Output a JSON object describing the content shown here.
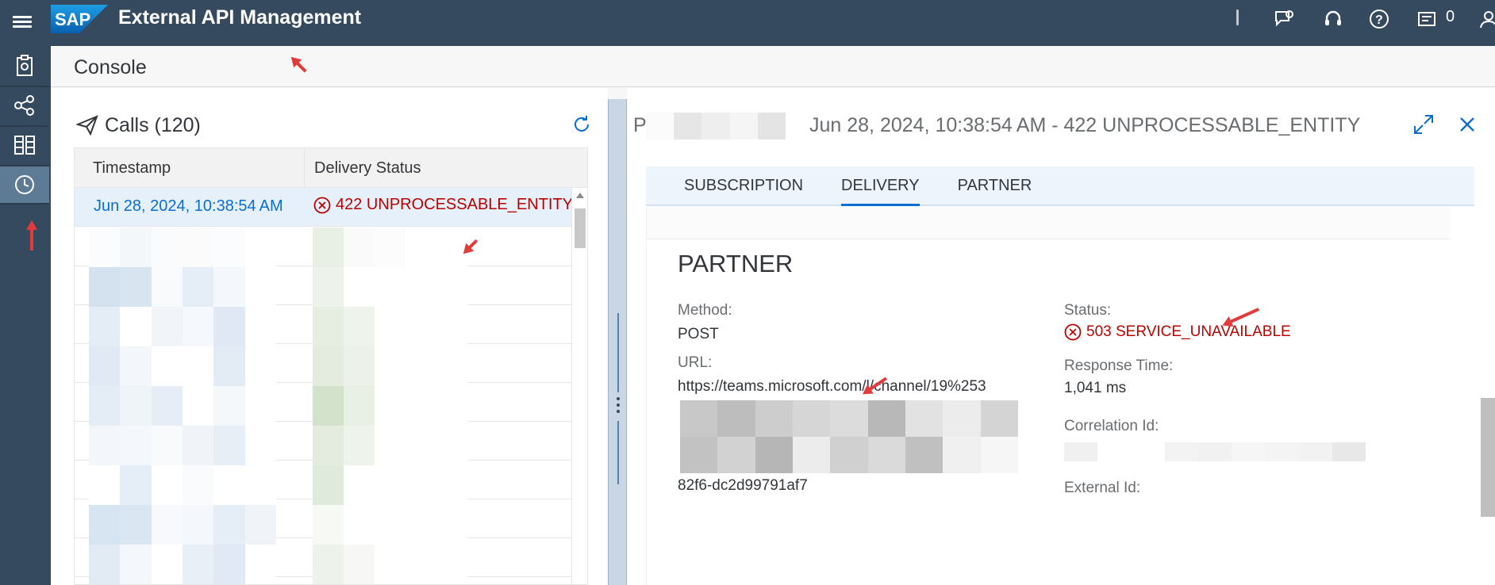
{
  "shell": {
    "title": "External API Management",
    "logo_text": "SAP",
    "notification_count": "0"
  },
  "sidenav": {
    "items": [
      {
        "name": "overview",
        "icon": "clipboard-icon"
      },
      {
        "name": "connections",
        "icon": "share-icon"
      },
      {
        "name": "catalog",
        "icon": "table-icon"
      },
      {
        "name": "console",
        "icon": "history-icon",
        "selected": true
      }
    ]
  },
  "page": {
    "title": "Console"
  },
  "calls": {
    "title": "Calls (120)",
    "columns": [
      "Timestamp",
      "Delivery Status"
    ],
    "rows": [
      {
        "timestamp": "Jun 28, 2024, 10:38:54 AM",
        "status": "422 UNPROCESSABLE_ENTITY",
        "selected": true
      }
    ]
  },
  "detail": {
    "prefix": "P",
    "title": "Jun 28, 2024, 10:38:54 AM - 422 UNPROCESSABLE_ENTITY",
    "tabs": [
      "SUBSCRIPTION",
      "DELIVERY",
      "PARTNER"
    ],
    "active_tab": "DELIVERY",
    "section_title": "PARTNER",
    "method_label": "Method:",
    "method_value": "POST",
    "url_label": "URL:",
    "url_line1": "https://teams.microsoft.com/l/channel/19%253",
    "url_line_last": "82f6-dc2d99791af7",
    "status_label": "Status:",
    "status_value": "503 SERVICE_UNAVAILABLE",
    "response_time_label": "Response Time:",
    "response_time_value": "1,041 ms",
    "correlation_label": "Correlation Id:",
    "external_label": "External Id:"
  },
  "colors": {
    "shell": "#354a5f",
    "accent": "#0a6ed1",
    "error": "#bb0000"
  }
}
